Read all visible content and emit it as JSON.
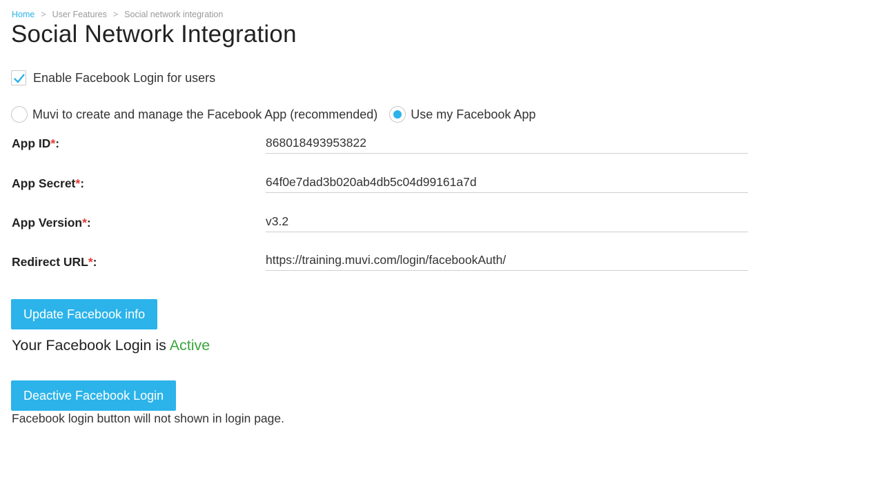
{
  "breadcrumb": {
    "home": "Home",
    "separator": ">",
    "section": "User Features",
    "current": "Social network integration"
  },
  "page_title": "Social Network Integration",
  "enable_checkbox": {
    "label": "Enable Facebook Login for users",
    "checked": true
  },
  "app_options": {
    "option1": "Muvi to create and manage the Facebook App (recommended)",
    "option2": "Use my Facebook App",
    "selected": "option2"
  },
  "fields": {
    "app_id": {
      "label": "App ID",
      "required_mark": "*",
      "colon": ":",
      "value": "868018493953822"
    },
    "app_secret": {
      "label": "App Secret",
      "required_mark": "*",
      "colon": ":",
      "value": "64f0e7dad3b020ab4db5c04d99161a7d"
    },
    "app_version": {
      "label": "App Version",
      "required_mark": "*",
      "colon": ":",
      "value": "v3.2"
    },
    "redirect_url": {
      "label": "Redirect URL",
      "required_mark": "*",
      "colon": ":",
      "value": "https://training.muvi.com/login/facebookAuth/"
    }
  },
  "update_button": "Update Facebook info",
  "status": {
    "prefix": "Your Facebook Login is ",
    "value": "Active"
  },
  "deactivate_button": "Deactive Facebook Login",
  "note": "Facebook login button will not shown in login page.",
  "colors": {
    "accent": "#2bb3ea",
    "active": "#3aa53a",
    "required": "#e53935"
  }
}
